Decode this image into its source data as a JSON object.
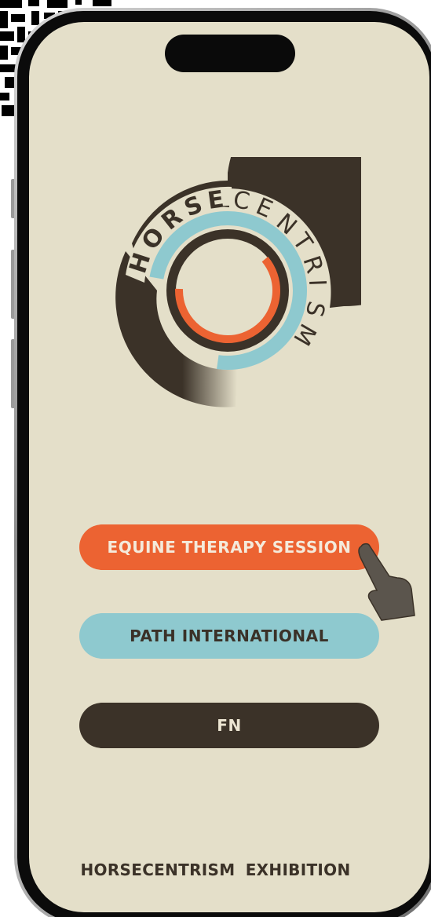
{
  "app": {
    "logo_text": "HORSECENTRISM",
    "logo_text_letters": [
      "H",
      "O",
      "R",
      "S",
      "E",
      "C",
      "E",
      "N",
      "T",
      "R",
      "I",
      "S",
      "M"
    ]
  },
  "buttons": {
    "equine_therapy": "EQUINE THERAPY SESSION",
    "path_international": "PATH INTERNATIONAL",
    "fn": "FN"
  },
  "footer": {
    "text": "HORSECENTRISM  EXHIBITION"
  },
  "icons": {
    "pointer": "hand-pointer-icon",
    "logo": "horsecentrism-logo"
  },
  "colors": {
    "background": "#e4dfc9",
    "orange": "#ec6332",
    "teal": "#8ec9cf",
    "dark_brown": "#3b3228",
    "cream_text": "#f4eadb"
  }
}
